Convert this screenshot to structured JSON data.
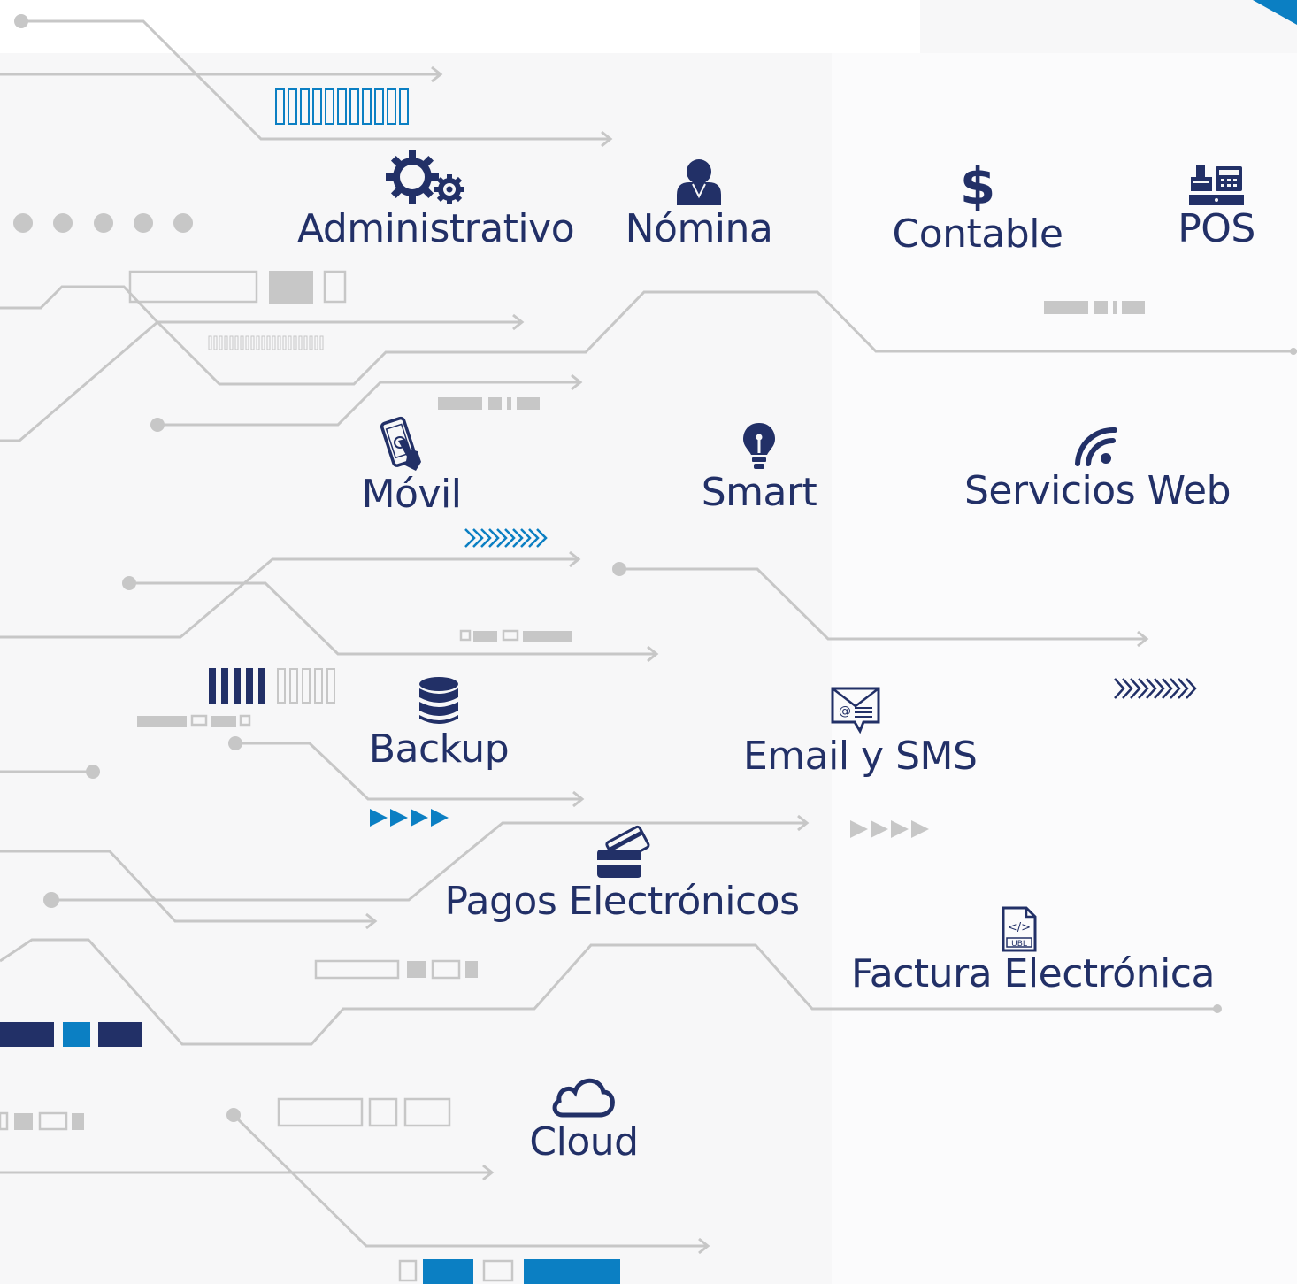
{
  "colors": {
    "navy": "#223067",
    "blue": "#0b7fc3",
    "line": "#c7c7c7",
    "background": "#f7f7f8"
  },
  "modules": [
    {
      "id": "administrativo",
      "label": "Administrativo",
      "icon": "gears-icon"
    },
    {
      "id": "nomina",
      "label": "Nómina",
      "icon": "person-icon"
    },
    {
      "id": "contable",
      "label": "Contable",
      "icon": "dollar-icon"
    },
    {
      "id": "pos",
      "label": "POS",
      "icon": "cash-register-icon"
    },
    {
      "id": "movil",
      "label": "Móvil",
      "icon": "smartphone-touch-icon"
    },
    {
      "id": "smart",
      "label": "Smart",
      "icon": "lightbulb-icon"
    },
    {
      "id": "servicios_web",
      "label": "Servicios Web",
      "icon": "wifi-icon"
    },
    {
      "id": "backup",
      "label": "Backup",
      "icon": "database-icon"
    },
    {
      "id": "email_sms",
      "label": "Email y SMS",
      "icon": "envelope-icon"
    },
    {
      "id": "pagos",
      "label": "Pagos Electrónicos",
      "icon": "payment-card-icon"
    },
    {
      "id": "factura",
      "label": "Factura Electrónica",
      "icon": "ubl-document-icon"
    },
    {
      "id": "cloud",
      "label": "Cloud",
      "icon": "cloud-icon"
    }
  ],
  "icon_texts": {
    "ubl": "UBL",
    "code": "</>",
    "email_at": "@"
  }
}
